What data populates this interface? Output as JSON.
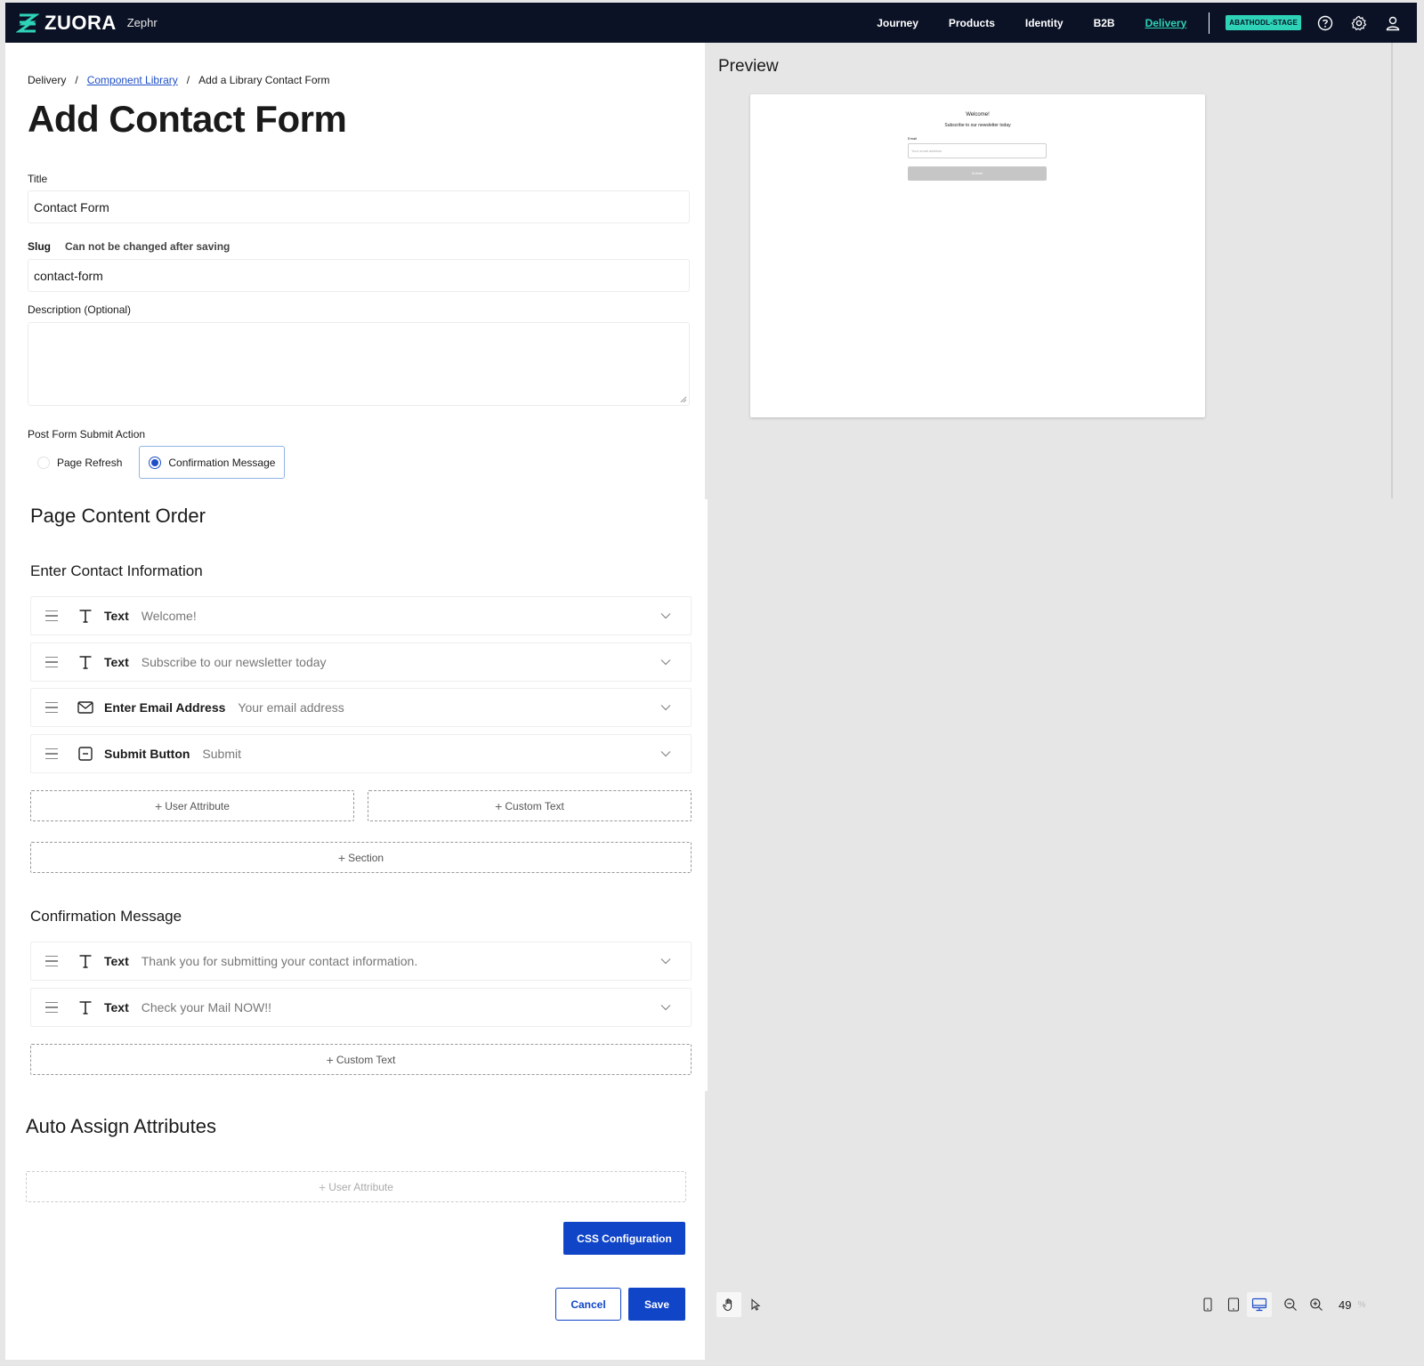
{
  "nav": {
    "brand": "ZUORA",
    "product": "Zephr",
    "items": [
      "Journey",
      "Products",
      "Identity",
      "B2B",
      "Delivery"
    ],
    "active": "Delivery",
    "env_badge": "ABATHODL-STAGE",
    "icons": [
      "help-icon",
      "gear-icon",
      "user-icon"
    ]
  },
  "breadcrumb": {
    "root": "Delivery",
    "sep": "/",
    "link": "Component Library",
    "current": "Add a Library Contact Form"
  },
  "page_title": "Add Contact Form",
  "form": {
    "title_label": "Title",
    "title_value": "Contact Form",
    "slug_label": "Slug",
    "slug_hint": "Can not be changed after saving",
    "slug_value": "contact-form",
    "description_label": "Description (Optional)",
    "description_value": "",
    "post_submit_label": "Post Form Submit Action",
    "post_submit_options": [
      "Page Refresh",
      "Confirmation Message"
    ],
    "post_submit_selected": "Confirmation Message"
  },
  "content_order": {
    "heading": "Page Content Order",
    "contact_section": {
      "heading": "Enter Contact Information",
      "rows": [
        {
          "type": "Text",
          "value": "Welcome!",
          "icon": "text-icon"
        },
        {
          "type": "Text",
          "value": "Subscribe to our newsletter today",
          "icon": "text-icon"
        },
        {
          "type": "Enter Email Address",
          "value": "Your email address",
          "icon": "envelope-icon"
        },
        {
          "type": "Submit Button",
          "value": "Submit",
          "icon": "button-icon"
        }
      ],
      "add_user_attribute": "User Attribute",
      "add_custom_text": "Custom Text",
      "add_section": "Section"
    },
    "confirmation_section": {
      "heading": "Confirmation Message",
      "rows": [
        {
          "type": "Text",
          "value": "Thank you for submitting your contact information.",
          "icon": "text-icon"
        },
        {
          "type": "Text",
          "value": "Check your Mail NOW!!",
          "icon": "text-icon"
        }
      ],
      "add_custom_text": "Custom Text"
    }
  },
  "auto_assign": {
    "heading": "Auto Assign Attributes",
    "add_user_attribute": "User Attribute"
  },
  "buttons": {
    "css_config": "CSS Configuration",
    "cancel": "Cancel",
    "save": "Save"
  },
  "preview": {
    "title": "Preview",
    "welcome": "Welcome!",
    "subtitle": "Subscribe to our newsletter today",
    "email_label": "Email",
    "email_placeholder": "Your email address",
    "submit": "Submit"
  },
  "toolbar": {
    "zoom_value": "49",
    "zoom_unit": "%"
  },
  "colors": {
    "nav_bg": "#0b1226",
    "accent": "#2ed3b7",
    "primary": "#1045c7"
  }
}
